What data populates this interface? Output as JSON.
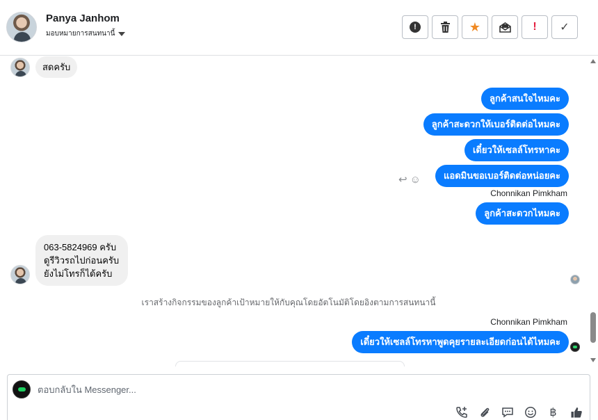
{
  "header": {
    "contact_name": "Panya Janhom",
    "assign_label": "มอบหมายการสนทนานี้",
    "toolbar": [
      {
        "name": "spam-button",
        "icon": "alert-circle-icon"
      },
      {
        "name": "delete-button",
        "icon": "trash-icon"
      },
      {
        "name": "star-button",
        "icon": "star-icon"
      },
      {
        "name": "mark-unread-button",
        "icon": "envelope-icon"
      },
      {
        "name": "follow-up-button",
        "icon": "exclamation-icon"
      },
      {
        "name": "done-button",
        "icon": "check-icon"
      }
    ]
  },
  "conversation": {
    "msg_in_1": "สดครับ",
    "out_1": "ลูกค้าสนใจไหมคะ",
    "out_2": "ลูกค้าสะดวกให้เบอร์ติดต่อไหมคะ",
    "out_3": "เดี๋ยวให้เซลล์โทรหาคะ",
    "out_4": "แอดมินขอเบอร์ติดต่อหน่อยคะ",
    "sender_1": "Chonnikan Pimkham",
    "out_5": "ลูกค้าสะดวกไหมคะ",
    "in_2_line1": "063-5824969 ครับ",
    "in_2_line2": "ดูรีวิวรถไปก่อนครับ",
    "in_2_line3": "ยังไม่โทรก็ได้ครับ",
    "system_note": "เราสร้างกิจกรรมของลูกค้าเป้าหมายให้กับคุณโดยอัตโนมัติโดยอิงตามการสนทนานี้",
    "sender_2": "Chonnikan Pimkham",
    "out_6": "เดี๋ยวให้เซลล์โทรหาพูดคุยรายละเอียดก่อนได้ไหมคะ"
  },
  "composer": {
    "placeholder": "ตอบกลับใน Messenger...",
    "tools": [
      "call-add-icon",
      "attachment-icon",
      "saved-reply-icon",
      "emoji-icon",
      "baht-icon",
      "like-icon"
    ]
  },
  "colors": {
    "outgoing_bubble": "#0a7cff",
    "incoming_bubble": "#f0f0f0",
    "star": "#f08a24",
    "flag": "#e41e3f"
  }
}
